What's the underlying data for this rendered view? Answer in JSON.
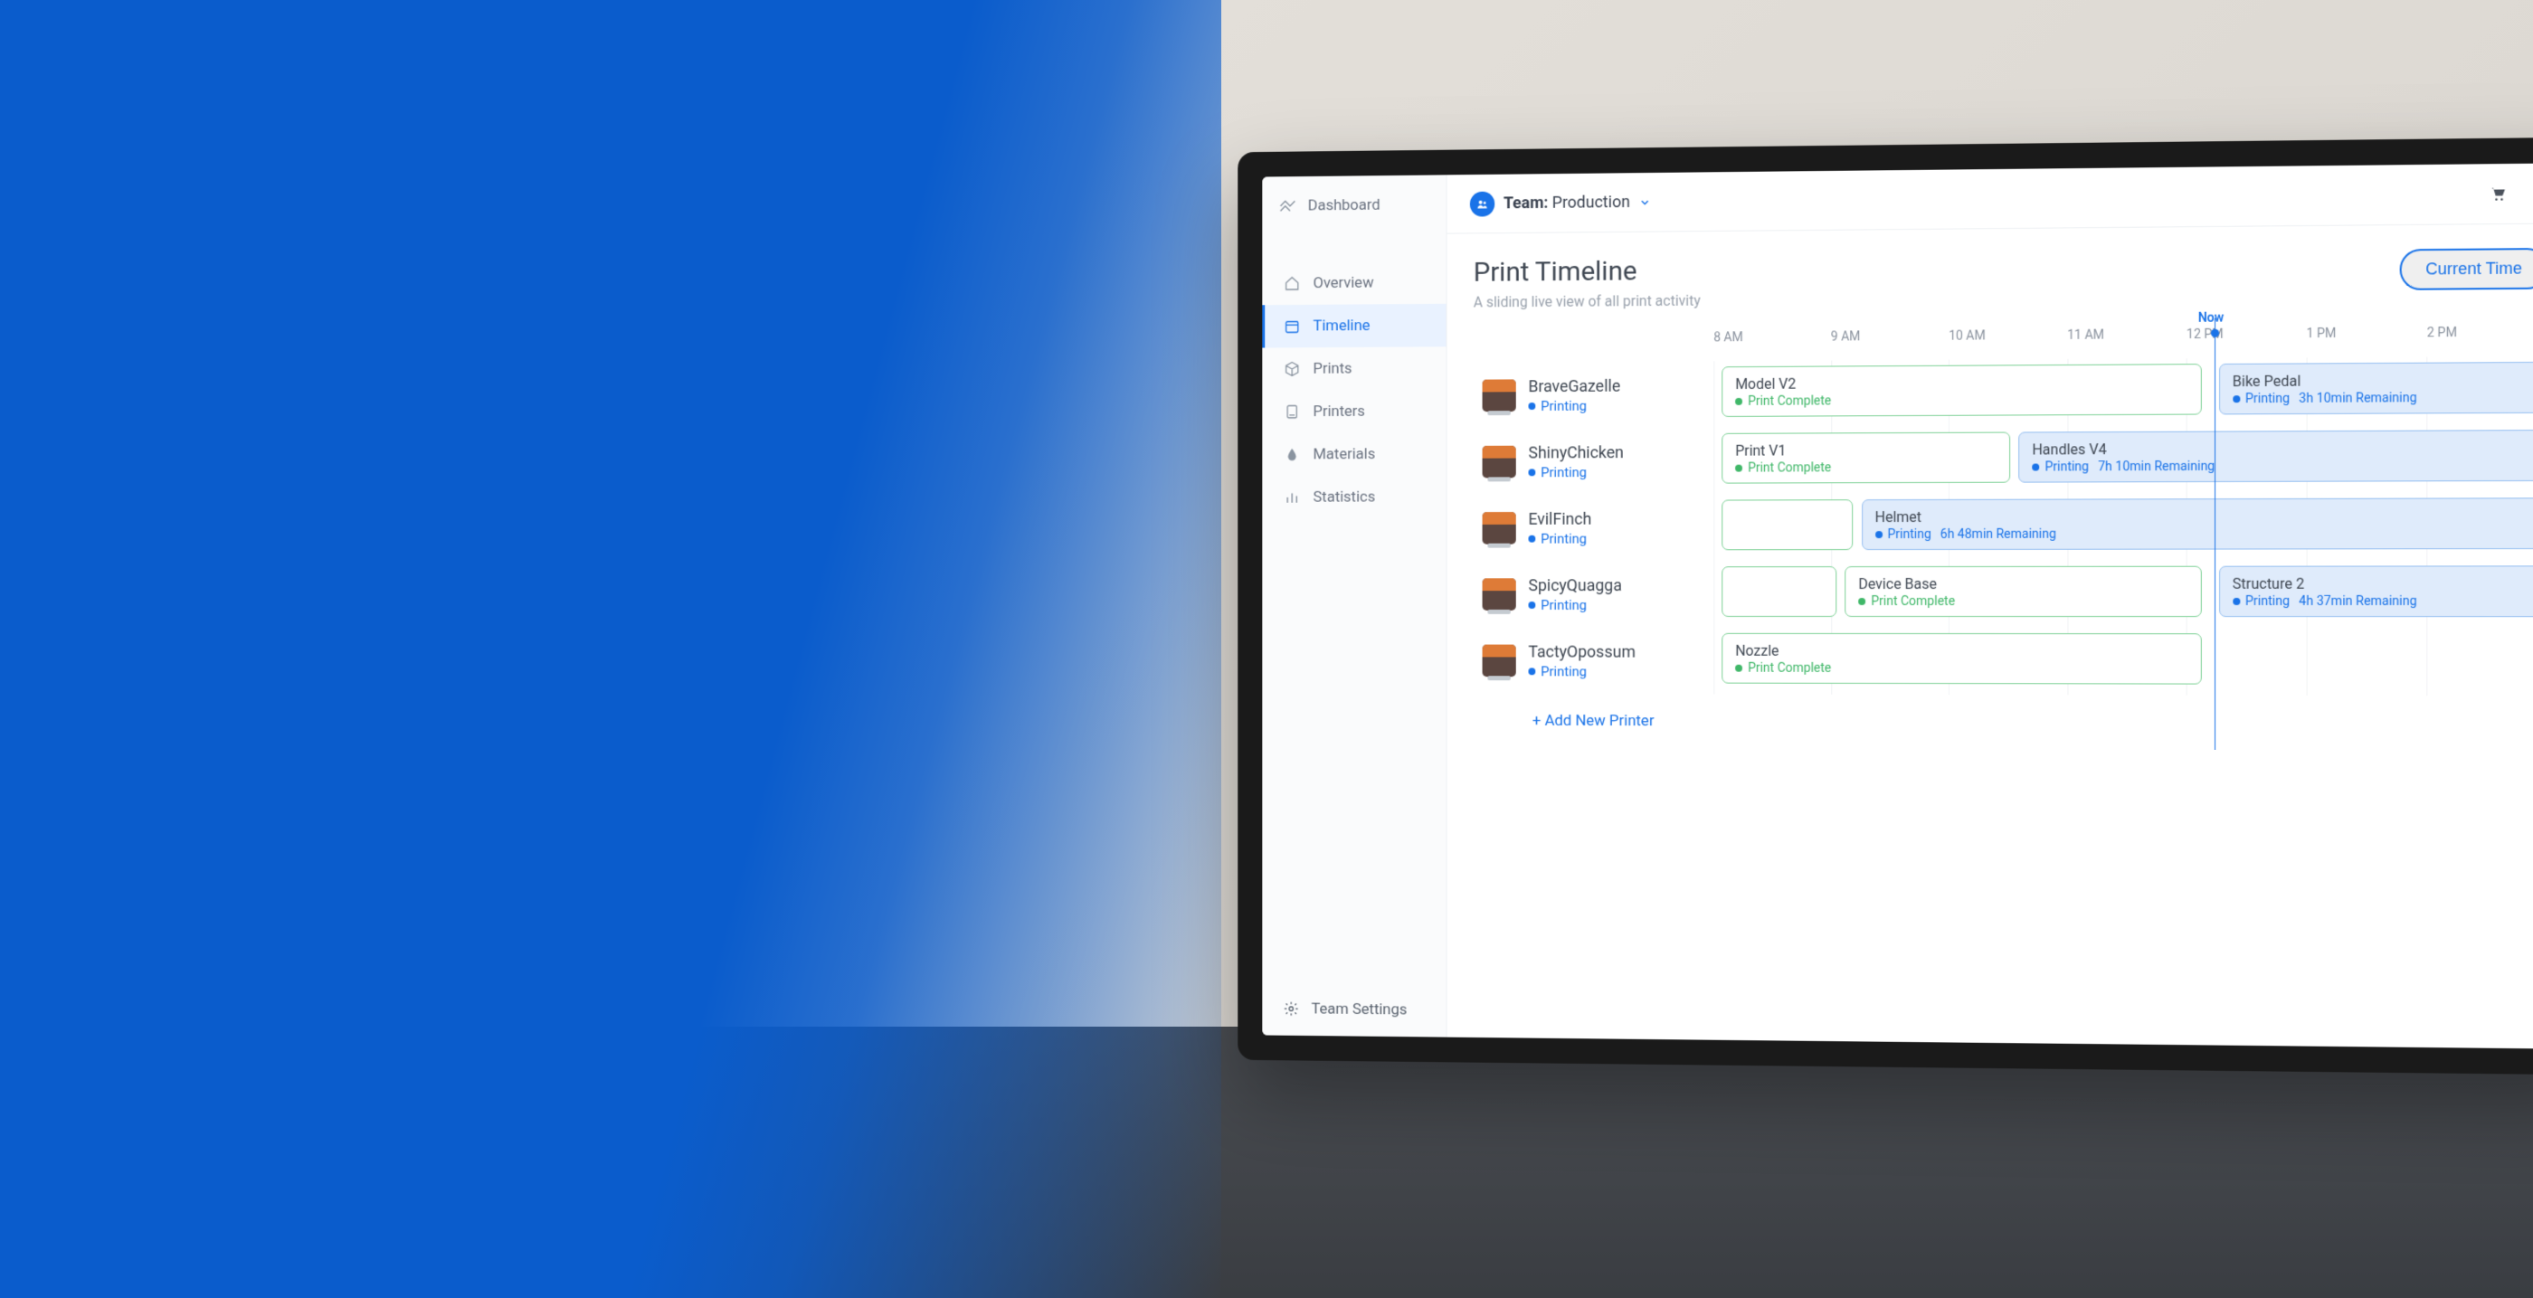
{
  "brand": "Dashboard",
  "sidebar": {
    "items": [
      {
        "label": "Overview"
      },
      {
        "label": "Timeline"
      },
      {
        "label": "Prints"
      },
      {
        "label": "Printers"
      },
      {
        "label": "Materials"
      },
      {
        "label": "Statistics"
      }
    ],
    "footer": "Team Settings"
  },
  "topbar": {
    "team_label": "Team:",
    "team_name": "Production"
  },
  "page": {
    "title": "Print Timeline",
    "subtitle": "A sliding live view of all print activity",
    "current_time_btn": "Current Time"
  },
  "timeline": {
    "now_label": "Now",
    "hours": [
      "8 AM",
      "9 AM",
      "10 AM",
      "11 AM",
      "12 PM",
      "1 PM",
      "2 PM"
    ],
    "add_printer": "+ Add New Printer",
    "printers": [
      {
        "name": "BraveGazelle",
        "status": "Printing"
      },
      {
        "name": "ShinyChicken",
        "status": "Printing"
      },
      {
        "name": "EvilFinch",
        "status": "Printing"
      },
      {
        "name": "SpicyQuagga",
        "status": "Printing"
      },
      {
        "name": "TactyOpossum",
        "status": "Printing"
      }
    ],
    "jobs": {
      "row0_a": {
        "name": "Model V2",
        "status": "Print Complete"
      },
      "row0_b": {
        "name": "Bike Pedal",
        "status": "Printing",
        "remaining": "3h 10min Remaining"
      },
      "row1_a": {
        "name": "Print V1",
        "status": "Print Complete"
      },
      "row1_b": {
        "name": "Handles V4",
        "status": "Printing",
        "remaining": "7h 10min Remaining"
      },
      "row2_a": {
        "name": "Helmet",
        "status": "Printing",
        "remaining": "6h 48min Remaining"
      },
      "row3_a": {
        "name": "Device Base",
        "status": "Print Complete"
      },
      "row3_b": {
        "name": "Structure 2",
        "status": "Printing",
        "remaining": "4h 37min Remaining"
      },
      "row4_a": {
        "name": "Nozzle",
        "status": "Print Complete"
      }
    }
  }
}
